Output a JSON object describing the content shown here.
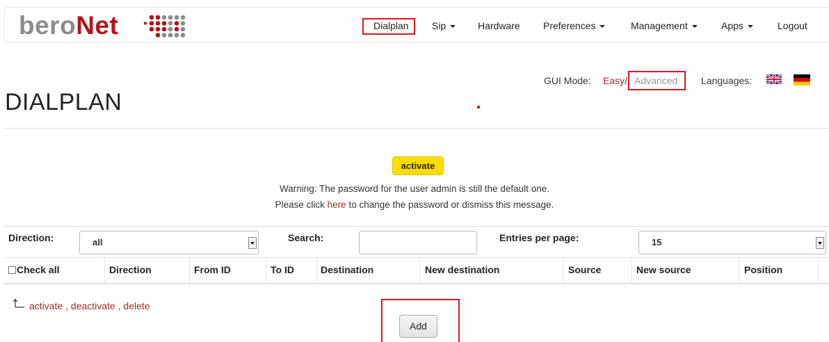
{
  "brand": {
    "part1": "bero",
    "part2": "Net"
  },
  "nav": {
    "dialplan": "Dialplan",
    "sip": "Sip",
    "hardware": "Hardware",
    "preferences": "Preferences",
    "management": "Management",
    "apps": "Apps",
    "logout": "Logout"
  },
  "gui_mode": {
    "label": "GUI Mode:",
    "easy": "Easy",
    "separator": "/",
    "advanced": "Advanced"
  },
  "languages": {
    "label": "Languages:",
    "options": [
      "English",
      "German"
    ]
  },
  "page_title": "DIALPLAN",
  "activate_button": "activate",
  "warning": {
    "line1": "Warning: The password for the user admin is still the default one.",
    "line2_pre": "Please click ",
    "link": "here",
    "line2_post": " to change the password or dismiss this message."
  },
  "filters": {
    "direction_label": "Direction:",
    "direction_value": "all",
    "search_label": "Search:",
    "search_value": "",
    "entries_label": "Entries per page:",
    "entries_value": "15"
  },
  "table": {
    "check_all": "Check all",
    "columns": [
      "Direction",
      "From ID",
      "To ID",
      "Destination",
      "New destination",
      "Source",
      "New source",
      "Position"
    ]
  },
  "bulk_actions": {
    "activate": "activate",
    "sep1": " , ",
    "deactivate": "deactivate",
    "sep2": " , ",
    "delete": "delete"
  },
  "add_button": "Add",
  "colors": {
    "brand_red": "#b3141b",
    "link_red": "#a02b2b",
    "highlight": "#e3121b",
    "activate_yellow": "#ffdd00"
  }
}
